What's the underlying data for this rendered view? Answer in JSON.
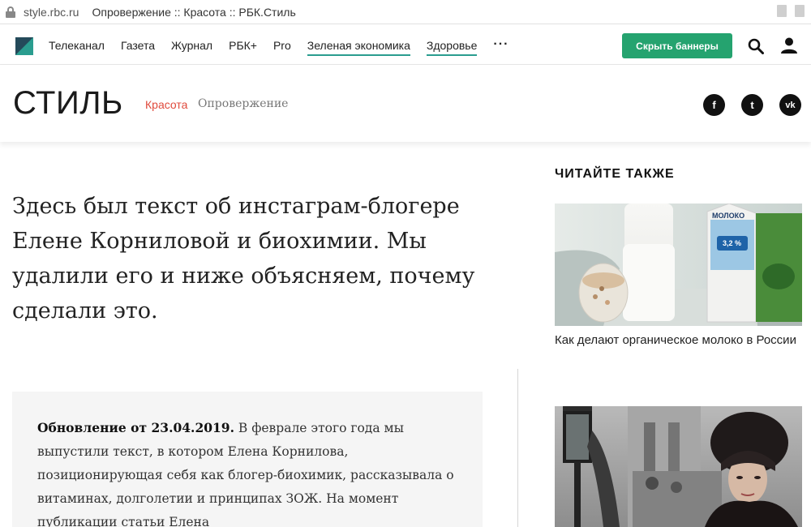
{
  "browser": {
    "url": "style.rbc.ru",
    "page_title": "Опровержение :: Красота :: РБК.Стиль"
  },
  "topnav": {
    "links": [
      {
        "label": "Телеканал",
        "underlined": false
      },
      {
        "label": "Газета",
        "underlined": false
      },
      {
        "label": "Журнал",
        "underlined": false
      },
      {
        "label": "РБК+",
        "underlined": false
      },
      {
        "label": "Pro",
        "underlined": false
      },
      {
        "label": "Зеленая экономика",
        "underlined": true
      },
      {
        "label": "Здоровье",
        "underlined": true
      }
    ],
    "more_label": "···",
    "hide_banners_label": "Скрыть баннеры",
    "accent_color": "#25a36f"
  },
  "section": {
    "brand": "СТИЛЬ",
    "crumb_category": "Красота",
    "crumb_page": "Опровержение",
    "social": [
      {
        "icon": "facebook-icon",
        "glyph": "f"
      },
      {
        "icon": "twitter-icon",
        "glyph": "t"
      },
      {
        "icon": "vk-icon",
        "glyph": "vk"
      }
    ]
  },
  "article": {
    "lead": "Здесь был текст об инстаграм-блогере Елене Корниловой и биохимии. Мы удалили его и ниже объясняем, почему сделали это.",
    "update_bold": "Обновление от 23.04.2019.",
    "update_text": " В феврале этого года мы выпустили текст, в котором Елена Корнилова, позиционирующая себя как блогер-биохимик, рассказывала о витаминах, долголетии и принципах ЗОЖ. На момент публикации статьи Елена"
  },
  "sidebar": {
    "title": "ЧИТАЙТЕ ТАКЖЕ",
    "cards": [
      {
        "caption": "Как делают органическое молоко в России",
        "image": "milk-photo"
      },
      {
        "caption": "",
        "image": "winter-portrait-photo"
      }
    ],
    "milk_label": "МОЛОКО",
    "milk_fat": "3,2 %"
  }
}
